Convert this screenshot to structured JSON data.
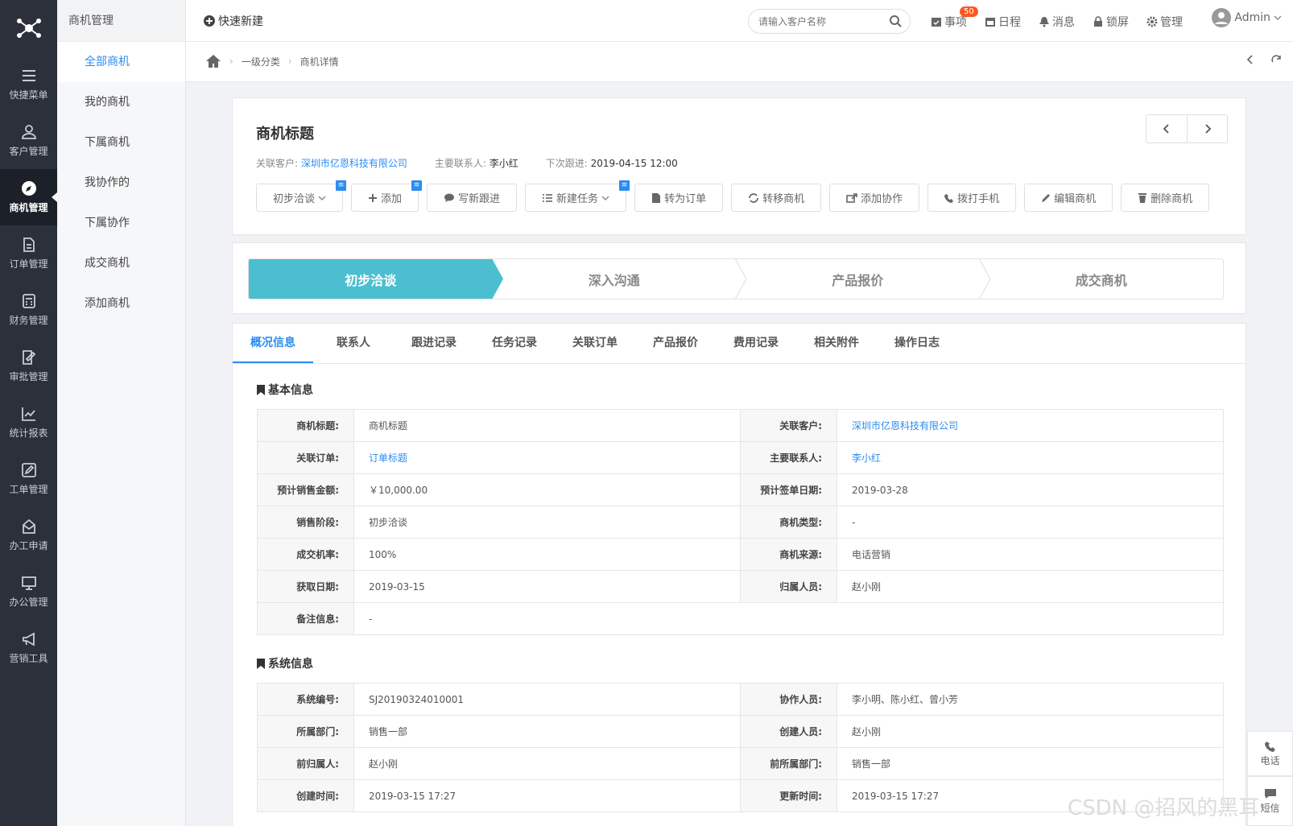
{
  "rail": {
    "items": [
      {
        "label": "快捷菜单",
        "icon": "menu-icon"
      },
      {
        "label": "客户管理",
        "icon": "users-icon"
      },
      {
        "label": "商机管理",
        "icon": "compass-icon"
      },
      {
        "label": "订单管理",
        "icon": "document-icon"
      },
      {
        "label": "财务管理",
        "icon": "calculator-icon"
      },
      {
        "label": "审批管理",
        "icon": "approval-icon"
      },
      {
        "label": "统计报表",
        "icon": "chart-icon"
      },
      {
        "label": "工单管理",
        "icon": "edit-icon"
      },
      {
        "label": "办工申请",
        "icon": "inbox-icon"
      },
      {
        "label": "办公管理",
        "icon": "monitor-icon"
      },
      {
        "label": "营销工具",
        "icon": "megaphone-icon"
      }
    ],
    "active_index": 2
  },
  "subnav": {
    "title": "商机管理",
    "links": [
      "全部商机",
      "我的商机",
      "下属商机",
      "我协作的",
      "下属协作",
      "成交商机",
      "添加商机"
    ]
  },
  "topbar": {
    "quick_new": "快速新建",
    "search_placeholder": "请输入客户名称",
    "tools": [
      {
        "label": "事项",
        "icon": "calendar-check-icon"
      },
      {
        "label": "日程",
        "icon": "calendar-icon"
      },
      {
        "label": "消息",
        "icon": "bell-icon"
      },
      {
        "label": "锁屏",
        "icon": "lock-icon"
      },
      {
        "label": "管理",
        "icon": "gear-icon"
      }
    ],
    "badge": "50",
    "user": "Admin"
  },
  "breadcrumb": {
    "level1": "一级分类",
    "level2": "商机详情"
  },
  "header": {
    "title": "商机标题",
    "customer_label": "关联客户:",
    "customer": "深圳市亿恩科技有限公司",
    "contact_label": "主要联系人:",
    "contact": "李小红",
    "next_label": "下次跟进:",
    "next": "2019-04-15 12:00"
  },
  "actions": [
    "初步洽谈",
    "添加",
    "写新跟进",
    "新建任务",
    "转为订单",
    "转移商机",
    "添加协作",
    "拨打手机",
    "编辑商机",
    "删除商机"
  ],
  "stages": [
    "初步洽谈",
    "深入沟通",
    "产品报价",
    "成交商机"
  ],
  "tabs": [
    "概况信息",
    "联系人",
    "跟进记录",
    "任务记录",
    "关联订单",
    "产品报价",
    "费用记录",
    "相关附件",
    "操作日志"
  ],
  "basic": {
    "title": "基本信息",
    "rows": [
      {
        "k1": "商机标题:",
        "v1": "商机标题",
        "k2": "关联客户:",
        "v2": "深圳市亿恩科技有限公司"
      },
      {
        "k1": "关联订单:",
        "v1": "订单标题",
        "k2": "主要联系人:",
        "v2": "李小红"
      },
      {
        "k1": "预计销售金额:",
        "v1": "￥10,000.00",
        "k2": "预计签单日期:",
        "v2": "2019-03-28"
      },
      {
        "k1": "销售阶段:",
        "v1": "初步洽谈",
        "k2": "商机类型:",
        "v2": "-"
      },
      {
        "k1": "成交机率:",
        "v1": "100%",
        "k2": "商机来源:",
        "v2": "电话营销"
      },
      {
        "k1": "获取日期:",
        "v1": "2019-03-15",
        "k2": "归属人员:",
        "v2": "赵小刚"
      },
      {
        "k1": "备注信息:",
        "v1": "-"
      }
    ]
  },
  "system": {
    "title": "系统信息",
    "rows": [
      {
        "k1": "系统编号:",
        "v1": "SJ20190324010001",
        "k2": "协作人员:",
        "v2": "李小明、陈小红、曾小芳"
      },
      {
        "k1": "所属部门:",
        "v1": "销售一部",
        "k2": "创建人员:",
        "v2": "赵小刚"
      },
      {
        "k1": "前归属人:",
        "v1": "赵小刚",
        "k2": "前所属部门:",
        "v2": "销售一部"
      },
      {
        "k1": "创建时间:",
        "v1": "2019-03-15 17:27",
        "k2": "更新时间:",
        "v2": "2019-03-15 17:27"
      }
    ]
  },
  "float": {
    "phone": "电话",
    "sms": "短信"
  },
  "watermark": "CSDN @招风的黑耳"
}
